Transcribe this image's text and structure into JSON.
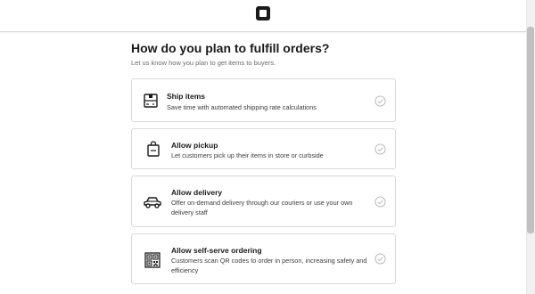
{
  "header": {
    "logo_icon": "square-logo-icon"
  },
  "main": {
    "title": "How do you plan to fulfill orders?",
    "subtitle": "Let us know how you plan to get items to buyers."
  },
  "options": [
    {
      "icon": "package-icon",
      "title": "Ship items",
      "description": "Save time with automated shipping rate calculations",
      "selected": false
    },
    {
      "icon": "shopping-bag-icon",
      "title": "Allow pickup",
      "description": "Let customers pick up their items in store or curbside",
      "selected": false
    },
    {
      "icon": "car-icon",
      "title": "Allow delivery",
      "description": "Offer on-demand delivery through our couriers or use your own delivery staff",
      "selected": false
    },
    {
      "icon": "qr-code-icon",
      "title": "Allow self-serve ordering",
      "description": "Customers scan QR codes to order in person, increasing safety and efficiency",
      "selected": false
    }
  ],
  "colors": {
    "border": "#d9d9d9",
    "check": "#b5b5b5",
    "text": "#1a1a1a"
  }
}
